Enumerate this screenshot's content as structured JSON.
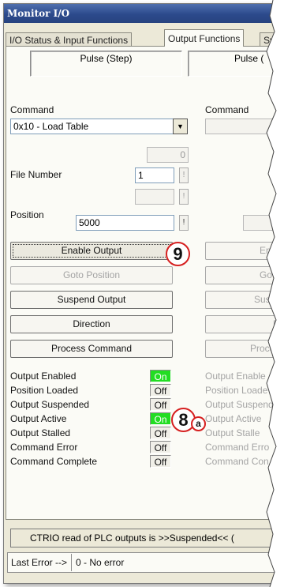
{
  "window": {
    "title": "Monitor I/O"
  },
  "tabs": [
    {
      "label": "I/O Status & Input Functions",
      "active": false
    },
    {
      "label": "Output Functions",
      "active": true
    },
    {
      "label": "Sy",
      "active": false
    }
  ],
  "channel1": {
    "header": "Pulse (Step)",
    "command_label": "Command",
    "command_value": "0x10 - Load Table",
    "small_field_value": "0",
    "file_number_label": "File Number",
    "file_number_value": "1",
    "position_label": "Position",
    "position_value": "5000",
    "small_btn_label": "!",
    "buttons": [
      {
        "label": "Enable Output",
        "enabled": true
      },
      {
        "label": "Goto Position",
        "enabled": false
      },
      {
        "label": "Suspend Output",
        "enabled": true
      },
      {
        "label": "Direction",
        "enabled": true
      },
      {
        "label": "Process Command",
        "enabled": true
      }
    ],
    "status": [
      {
        "label": "Output Enabled",
        "value": "On"
      },
      {
        "label": "Position Loaded",
        "value": "Off"
      },
      {
        "label": "Output Suspended",
        "value": "Off"
      },
      {
        "label": "Output Active",
        "value": "On"
      },
      {
        "label": "Output Stalled",
        "value": "Off"
      },
      {
        "label": "Command Error",
        "value": "Off"
      },
      {
        "label": "Command Complete",
        "value": "Off"
      }
    ]
  },
  "channel2": {
    "header": "Pulse (",
    "command_label": "Command",
    "buttons": [
      "Enab",
      "Goto",
      "Suspe",
      "D",
      "Proces"
    ],
    "status": [
      "Output Enable",
      "Position Loade",
      "Output Suspend",
      "Output Active",
      "Output Stalle",
      "Command Erro",
      "Command Con"
    ]
  },
  "callouts": {
    "nine": "9",
    "eight": "8",
    "a": "a"
  },
  "footer": {
    "ctrio_message": "CTRIO read of PLC outputs is >>Suspended<< (",
    "last_error_label": "Last Error -->",
    "last_error_value": "0 - No error"
  },
  "colors": {
    "on_indicator": "#22dd22",
    "callout_border": "#d62020",
    "titlebar": "#2c4a8c"
  }
}
